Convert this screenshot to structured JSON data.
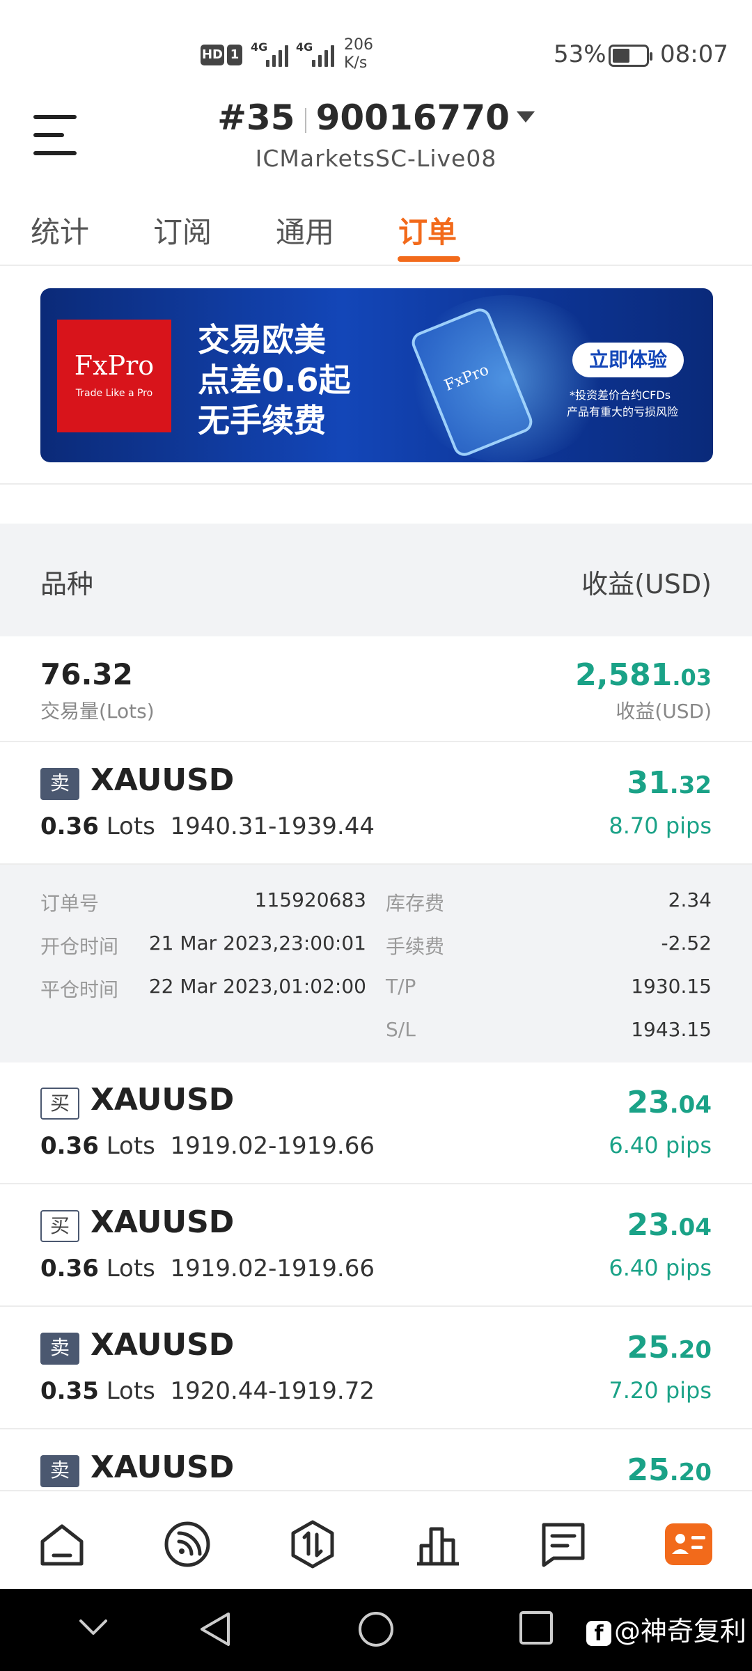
{
  "status_bar": {
    "hd": "HD",
    "sim": "1",
    "net1": "4G",
    "net2": "4G",
    "speed_value": "206",
    "speed_unit": "K/s",
    "battery_pct": "53%",
    "battery_level": 0.53,
    "time": "08:07"
  },
  "header": {
    "account_prefix": "#35",
    "account_number": "90016770",
    "server": "ICMarketsSC-Live08"
  },
  "tabs": [
    {
      "label": "统计"
    },
    {
      "label": "订阅"
    },
    {
      "label": "通用"
    },
    {
      "label": "订单"
    }
  ],
  "banner": {
    "logo": "FxPro",
    "logo_tagline": "Trade Like a Pro",
    "line1": "交易欧美",
    "line2": "点差0.6起",
    "line3": "无手续费",
    "phone_logo": "FxPro",
    "cta": "立即体验",
    "note1": "*投资差价合约CFDs",
    "note2": "产品有重大的亏损风险"
  },
  "table_header": {
    "symbol": "品种",
    "profit": "收益(USD)"
  },
  "summary": {
    "lots": "76.32",
    "lots_label": "交易量(Lots)",
    "profit_int": "2,581",
    "profit_dec": ".03",
    "profit_label": "收益(USD)"
  },
  "orders": [
    {
      "side": "卖",
      "symbol": "XAUUSD",
      "lots": "0.36",
      "lots_unit": "Lots",
      "prices": "1940.31-1939.44",
      "profit_int": "31",
      "profit_dec": ".32",
      "pips": "8.70 pips"
    },
    {
      "side": "买",
      "symbol": "XAUUSD",
      "lots": "0.36",
      "lots_unit": "Lots",
      "prices": "1919.02-1919.66",
      "profit_int": "23",
      "profit_dec": ".04",
      "pips": "6.40 pips"
    },
    {
      "side": "买",
      "symbol": "XAUUSD",
      "lots": "0.36",
      "lots_unit": "Lots",
      "prices": "1919.02-1919.66",
      "profit_int": "23",
      "profit_dec": ".04",
      "pips": "6.40 pips"
    },
    {
      "side": "卖",
      "symbol": "XAUUSD",
      "lots": "0.35",
      "lots_unit": "Lots",
      "prices": "1920.44-1919.72",
      "profit_int": "25",
      "profit_dec": ".20",
      "pips": "7.20 pips"
    },
    {
      "side": "卖",
      "symbol": "XAUUSD",
      "profit_int": "25",
      "profit_dec": ".20"
    }
  ],
  "details": {
    "order_no_label": "订单号",
    "order_no": "115920683",
    "open_time_label": "开仓时间",
    "open_time": "21 Mar 2023,23:00:01",
    "close_time_label": "平仓时间",
    "close_time": "22 Mar 2023,01:02:00",
    "swap_label": "库存费",
    "swap": "2.34",
    "commission_label": "手续费",
    "commission": "-2.52",
    "tp_label": "T/P",
    "tp": "1930.15",
    "sl_label": "S/L",
    "sl": "1943.15"
  },
  "bottom_nav": [
    {
      "icon": "home-icon"
    },
    {
      "icon": "signal-feed-icon"
    },
    {
      "icon": "trade-icon"
    },
    {
      "icon": "chart-bars-icon"
    },
    {
      "icon": "message-icon"
    },
    {
      "icon": "profile-card-icon"
    }
  ],
  "colors": {
    "accent": "#f26a1b",
    "profit": "#1aa287",
    "sell_badge": "#4b5870"
  },
  "watermark": "@神奇复利",
  "watermark_icon": "f"
}
